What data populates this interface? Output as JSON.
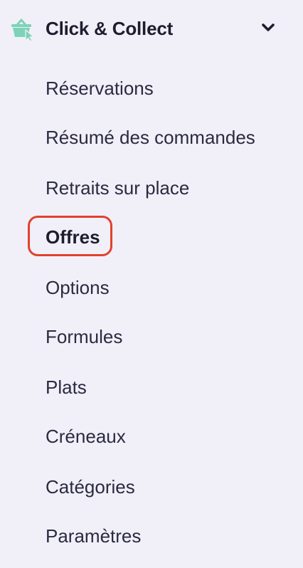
{
  "section": {
    "title": "Click & Collect",
    "icon": "basket-cursor-icon",
    "expanded_icon": "chevron-down-icon",
    "accent_color": "#7dd3b8"
  },
  "menu": {
    "items": [
      {
        "label": "Réservations",
        "active": false
      },
      {
        "label": "Résumé des commandes",
        "active": false
      },
      {
        "label": "Retraits sur place",
        "active": false
      },
      {
        "label": "Offres",
        "active": true,
        "highlighted": true
      },
      {
        "label": "Options",
        "active": false
      },
      {
        "label": "Formules",
        "active": false
      },
      {
        "label": "Plats",
        "active": false
      },
      {
        "label": "Créneaux",
        "active": false
      },
      {
        "label": "Catégories",
        "active": false
      },
      {
        "label": "Paramètres",
        "active": false
      }
    ]
  },
  "colors": {
    "background": "#f1f0f9",
    "text": "#2b2a40",
    "highlight_ring": "#e2412b"
  }
}
